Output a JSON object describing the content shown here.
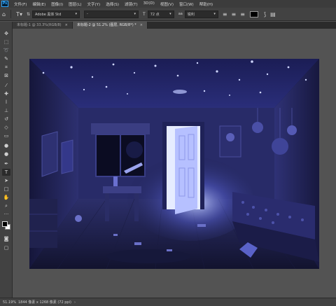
{
  "menu": [
    "文件(F)",
    "编辑(E)",
    "图像(I)",
    "图层(L)",
    "文字(Y)",
    "选择(S)",
    "滤镜(T)",
    "3D(D)",
    "视图(V)",
    "窗口(W)",
    "帮助(H)"
  ],
  "options": {
    "font_family": "Adobe 黑体 Std",
    "font_style": "-",
    "font_size": "72 点",
    "antialias": "锐利",
    "color": "#000000"
  },
  "tabs": [
    {
      "label": "未标题-1 @ 33.3%(RGB/8)",
      "active": false
    },
    {
      "label": "未标题-2 @ 51.2% (图层, RGB/8*) *",
      "active": true
    }
  ],
  "tools": [
    "move-tool",
    "marquee-tool",
    "lasso-tool",
    "quick-select-tool",
    "crop-tool",
    "frame-tool",
    "eyedropper-tool",
    "healing-brush-tool",
    "brush-tool",
    "clone-stamp-tool",
    "history-brush-tool",
    "eraser-tool",
    "gradient-tool",
    "blur-tool",
    "dodge-tool",
    "pen-tool",
    "type-tool",
    "path-select-tool",
    "rectangle-tool",
    "hand-tool",
    "zoom-tool",
    "more-tools-icon"
  ],
  "status": {
    "zoom": "51.19%",
    "doc_info": "1844 像素 x 1268 像素 (72 ppi)"
  }
}
